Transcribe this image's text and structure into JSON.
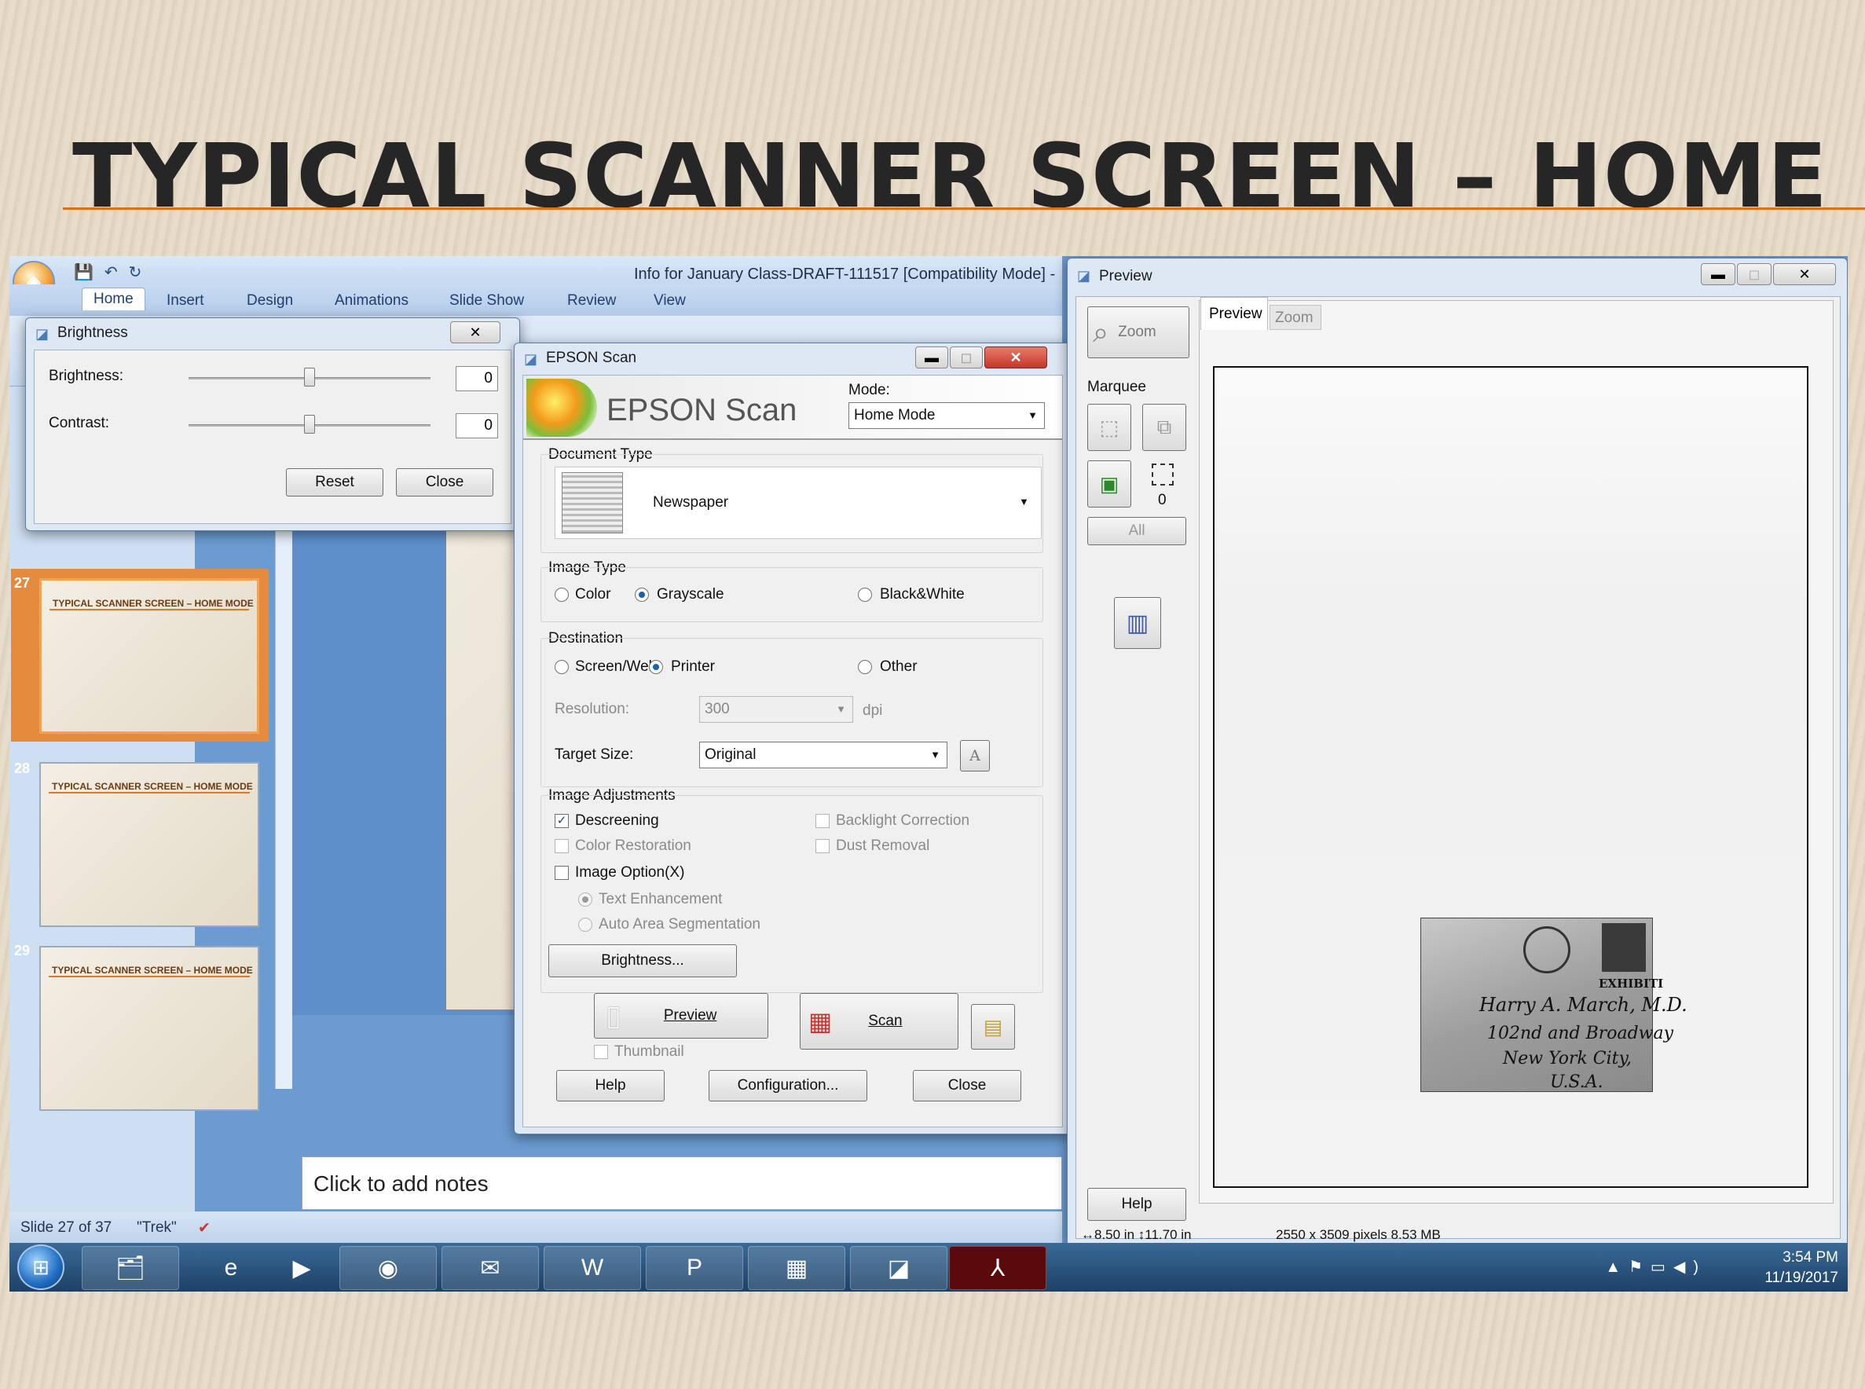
{
  "slide": {
    "title": "TYPICAL SCANNER SCREEN – HOME MODE"
  },
  "powerpoint": {
    "doc_title": "Info for January Class-DRAFT-111517 [Compatibility Mode] -",
    "tabs": [
      "Home",
      "Insert",
      "Design",
      "Animations",
      "Slide Show",
      "Review",
      "View"
    ],
    "thumbnails": [
      {
        "num": "27",
        "title": "TYPICAL SCANNER SCREEN – HOME MODE",
        "selected": true
      },
      {
        "num": "28",
        "title": "TYPICAL SCANNER SCREEN – HOME MODE",
        "selected": false
      },
      {
        "num": "29",
        "title": "TYPICAL SCANNER SCREEN – HOME MODE",
        "selected": false
      }
    ],
    "notes_placeholder": "Click to add notes",
    "status": {
      "slide": "Slide 27 of 37",
      "theme": "\"Trek\""
    }
  },
  "brightness_dialog": {
    "title": "Brightness",
    "brightness_label": "Brightness:",
    "brightness_value": "0",
    "contrast_label": "Contrast:",
    "contrast_value": "0",
    "reset": "Reset",
    "close": "Close",
    "close_x": "✕",
    "brightness_level": 0.5,
    "contrast_level": 0.5
  },
  "epson": {
    "title": "EPSON Scan",
    "logo_text": "EPSON Scan",
    "mode_label": "Mode:",
    "mode_value": "Home Mode",
    "document_type": {
      "label": "Document Type",
      "value": "Newspaper"
    },
    "image_type": {
      "label": "Image Type",
      "options": [
        "Color",
        "Grayscale",
        "Black&White"
      ],
      "selected": "Grayscale"
    },
    "destination": {
      "label": "Destination",
      "options": [
        "Screen/Web",
        "Printer",
        "Other"
      ],
      "selected": "Printer"
    },
    "resolution_label": "Resolution:",
    "resolution_value": "300",
    "resolution_unit": "dpi",
    "target_size_label": "Target Size:",
    "target_size_value": "Original",
    "target_icon": "A",
    "adjustments": {
      "label": "Image Adjustments",
      "descreening": "Descreening",
      "backlight": "Backlight Correction",
      "color_restoration": "Color Restoration",
      "dust_removal": "Dust Removal",
      "image_option": "Image Option(X)",
      "text_enhancement": "Text Enhancement",
      "auto_area": "Auto Area Segmentation",
      "brightness_btn": "Brightness..."
    },
    "preview_btn": "Preview",
    "scan_btn": "Scan",
    "thumbnail": "Thumbnail",
    "help": "Help",
    "configuration": "Configuration...",
    "close": "Close"
  },
  "preview_window": {
    "title": "Preview",
    "zoom_btn": "Zoom",
    "marquee_label": "Marquee",
    "marquee_count": "0",
    "all_btn": "All",
    "tab_preview": "Preview",
    "tab_zoom": "Zoom",
    "help": "Help",
    "status_size": "↔8.50 in  ↕11.70 in",
    "status_pixels": "2550 x 3509 pixels 8.53 MB",
    "envelope": {
      "line1": "Harry A. March, M.D.",
      "line2": "102nd and Broadway",
      "line3": "New York City,",
      "line4": "U.S.A.",
      "stamp": "EXHIBITI"
    }
  },
  "taskbar": {
    "time": "3:54 PM",
    "date": "11/19/2017"
  }
}
